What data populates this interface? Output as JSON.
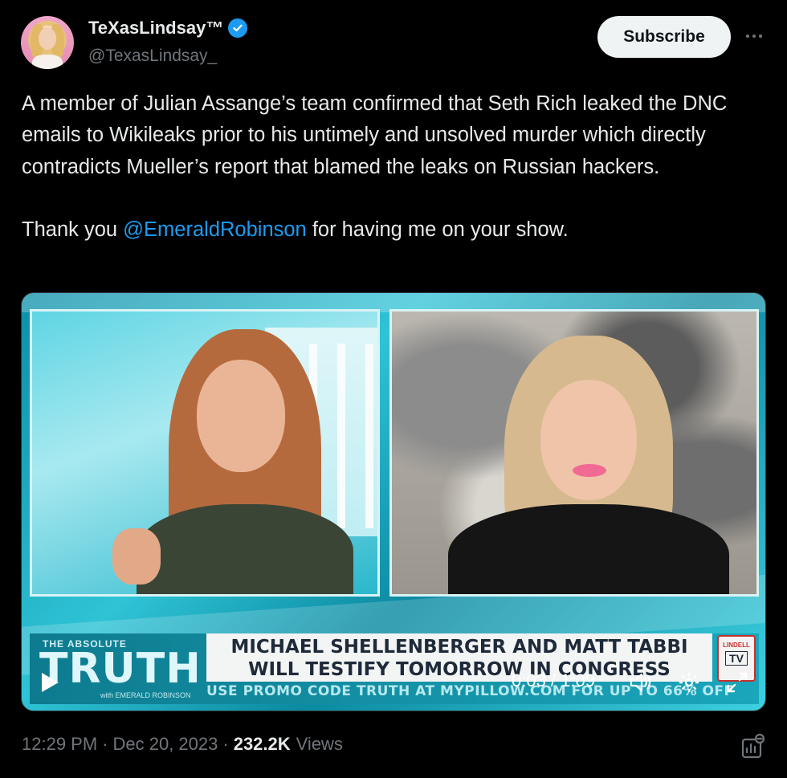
{
  "author": {
    "display_name": "TeXasLindsay™",
    "handle": "@TexasLindsay_",
    "verified": true
  },
  "actions": {
    "subscribe_label": "Subscribe",
    "more_icon": "more-horizontal-icon"
  },
  "post": {
    "paragraph1": "A member of Julian Assange’s team confirmed that Seth Rich leaked the DNC emails to Wikileaks prior to his untimely and unsolved murder which directly contradicts Mueller’s report that blamed the leaks on Russian hackers.",
    "thanks_prefix": "Thank you ",
    "mention": "@EmeraldRobinson",
    "thanks_suffix": " for having me on your show."
  },
  "video": {
    "show_kicker": "THE ABSOLUTE",
    "show_name": "TRUTH",
    "show_host": "with EMERALD ROBINSON",
    "headline_line1": "MICHAEL SHELLENBERGER AND MATT TABBI",
    "headline_line2": "WILL TESTIFY TOMORROW IN CONGRESS",
    "promo": "USE PROMO CODE TRUTH AT MYPILLOW.COM FOR UP TO 66% OFF",
    "network_label": "LINDELL",
    "network_tv": "TV",
    "timecode": "0:03 / 1:09",
    "controls": [
      "play-icon",
      "volume-icon",
      "settings-icon",
      "fullscreen-icon"
    ]
  },
  "footer": {
    "time": "12:29 PM",
    "date": "Dec 20, 2023",
    "views_count": "232.2K",
    "views_label": "Views",
    "separator": "·"
  },
  "colors": {
    "background": "#000000",
    "text": "#e7e9ea",
    "muted": "#71767b",
    "link": "#1d9bf0",
    "button_bg": "#eff3f4"
  }
}
